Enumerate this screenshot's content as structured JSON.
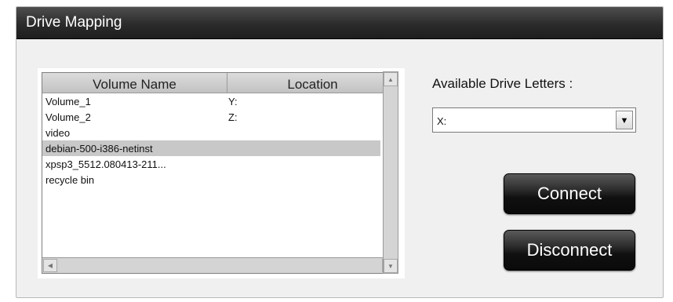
{
  "dialog": {
    "title": "Drive Mapping"
  },
  "volumes": {
    "columns": {
      "name": "Volume Name",
      "location": "Location"
    },
    "rows": [
      {
        "name": "Volume_1",
        "location": "Y:",
        "selected": false
      },
      {
        "name": "Volume_2",
        "location": "Z:",
        "selected": false
      },
      {
        "name": "video",
        "location": "",
        "selected": false
      },
      {
        "name": "debian-500-i386-netinst",
        "location": "",
        "selected": true
      },
      {
        "name": "xpsp3_5512.080413-211...",
        "location": "",
        "selected": false
      },
      {
        "name": "recycle bin",
        "location": "",
        "selected": false
      }
    ]
  },
  "drive_letters": {
    "label": "Available Drive Letters :",
    "selected": "X:"
  },
  "buttons": {
    "connect": "Connect",
    "disconnect": "Disconnect"
  },
  "icons": {
    "scroll_up": "arrow-up-icon",
    "scroll_down": "arrow-down-icon",
    "scroll_left": "arrow-left-icon",
    "scroll_right": "arrow-right-icon",
    "dropdown": "chevron-down-icon"
  },
  "colors": {
    "title_bar": "#2b2b2b",
    "selected_row": "#c8c8c8",
    "button": "#1a1a1a"
  }
}
